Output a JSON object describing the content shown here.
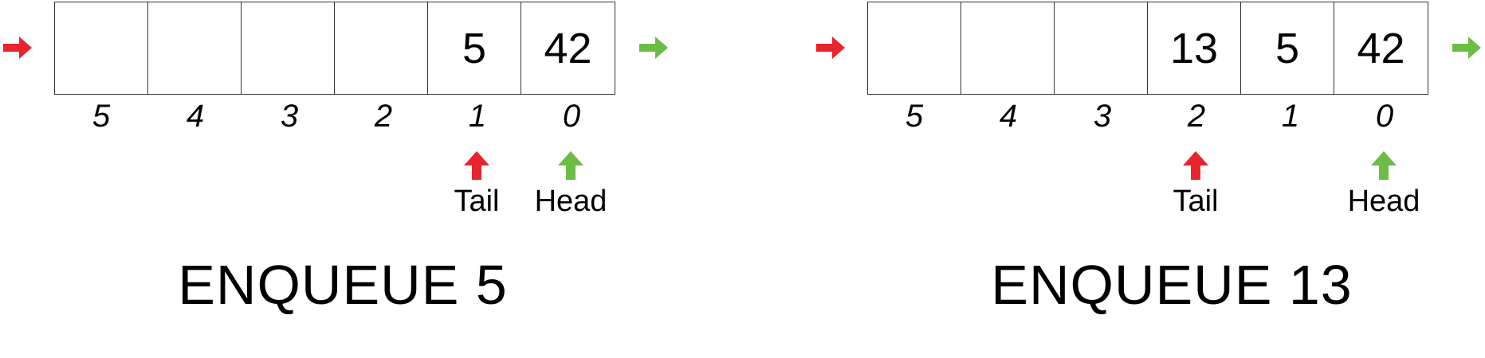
{
  "colors": {
    "in_arrow": "#e8242c",
    "out_arrow": "#6cbd45",
    "cell_border": "#333333"
  },
  "panels": [
    {
      "cells": [
        "",
        "",
        "",
        "",
        "5",
        "42"
      ],
      "indices": [
        "5",
        "4",
        "3",
        "2",
        "1",
        "0"
      ],
      "tail_label": "Tail",
      "head_label": "Head",
      "tail_index": 1,
      "head_index": 0,
      "title": "ENQUEUE 5"
    },
    {
      "cells": [
        "",
        "",
        "",
        "13",
        "5",
        "42"
      ],
      "indices": [
        "5",
        "4",
        "3",
        "2",
        "1",
        "0"
      ],
      "tail_label": "Tail",
      "head_label": "Head",
      "tail_index": 2,
      "head_index": 0,
      "title": "ENQUEUE 13"
    }
  ]
}
